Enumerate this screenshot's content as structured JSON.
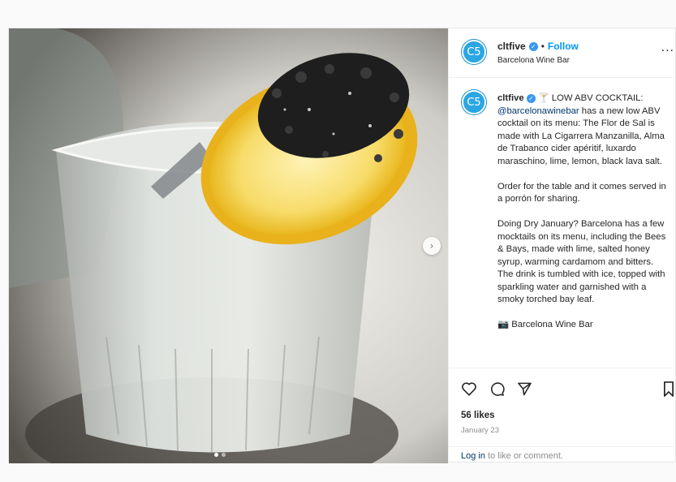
{
  "post": {
    "username": "cltfive",
    "avatar_text": "C5",
    "follow_label": "Follow",
    "separator": "•",
    "location": "Barcelona Wine Bar",
    "more_label": "..."
  },
  "caption": {
    "username": "cltfive",
    "emoji": "🍸",
    "paragraph1_prefix": "LOW ABV COCKTAIL:",
    "mention": "@barcelonawinebar",
    "paragraph1_rest": "has a new low ABV cocktail on its menu: The Flor de Sal is made with La Cigarrera Manzanilla, Alma de Trabanco cider apéritif, luxardo maraschino, lime, lemon, black lava salt.",
    "paragraph2": "Order for the table and it comes served in a porrón for sharing.",
    "paragraph3": "Doing Dry January? Barcelona has a few mocktails on its menu, including the Bees & Bays, made with lime, salted honey syrup, warming cardamom and bitters. The drink is tumbled with ice, topped with sparkling water and garnished with a smoky torched bay leaf.",
    "paragraph4": "📷 Barcelona Wine Bar"
  },
  "engagement": {
    "likes": "56 likes",
    "date": "January 23",
    "login_link": "Log in",
    "login_rest": " to like or comment."
  },
  "icons": {
    "like": "heart-icon",
    "comment": "comment-icon",
    "share": "share-icon",
    "save": "bookmark-icon",
    "next": "chevron-right-icon"
  },
  "colors": {
    "accent": "#0095f6",
    "avatar": "#2aa6e4",
    "verified": "#3897f0"
  }
}
